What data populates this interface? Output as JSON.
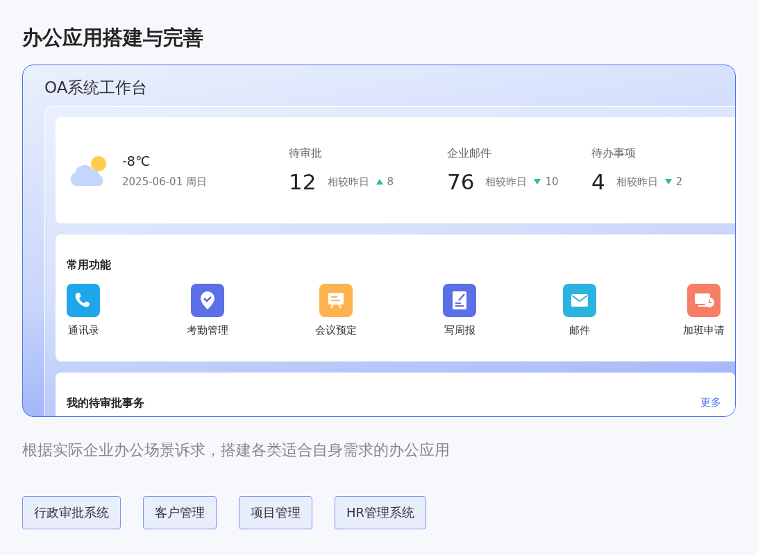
{
  "page_title": "办公应用搭建与完善",
  "workbench": {
    "title": "OA系统工作台",
    "weather": {
      "temperature": "-8℃",
      "date": "2025-06-01 周日"
    },
    "stats": [
      {
        "label": "待审批",
        "value": "12",
        "compare": "相较昨日",
        "up": true,
        "delta": "8"
      },
      {
        "label": "企业邮件",
        "value": "76",
        "compare": "相较昨日",
        "up": false,
        "delta": "10"
      },
      {
        "label": "待办事项",
        "value": "4",
        "compare": "相较昨日",
        "up": false,
        "delta": "2"
      }
    ],
    "functions": {
      "title": "常用功能",
      "items": [
        {
          "label": "通讯录",
          "kind": "phone",
          "color": "#1ea7e8"
        },
        {
          "label": "考勤管理",
          "kind": "location",
          "color": "#5b6fe6"
        },
        {
          "label": "会议预定",
          "kind": "board",
          "color": "#fdb44f"
        },
        {
          "label": "写周报",
          "kind": "document",
          "color": "#5b6fe6"
        },
        {
          "label": "邮件",
          "kind": "mail",
          "color": "#2bb3e0"
        },
        {
          "label": "加班申请",
          "kind": "monitor",
          "color": "#f77d68"
        }
      ]
    },
    "approvals": {
      "title": "我的待审批事务",
      "more": "更多"
    }
  },
  "description": "根据实际企业办公场景诉求，搭建各类适合自身需求的办公应用",
  "tags": [
    "行政审批系统",
    "客户管理",
    "项目管理",
    "HR管理系统"
  ]
}
